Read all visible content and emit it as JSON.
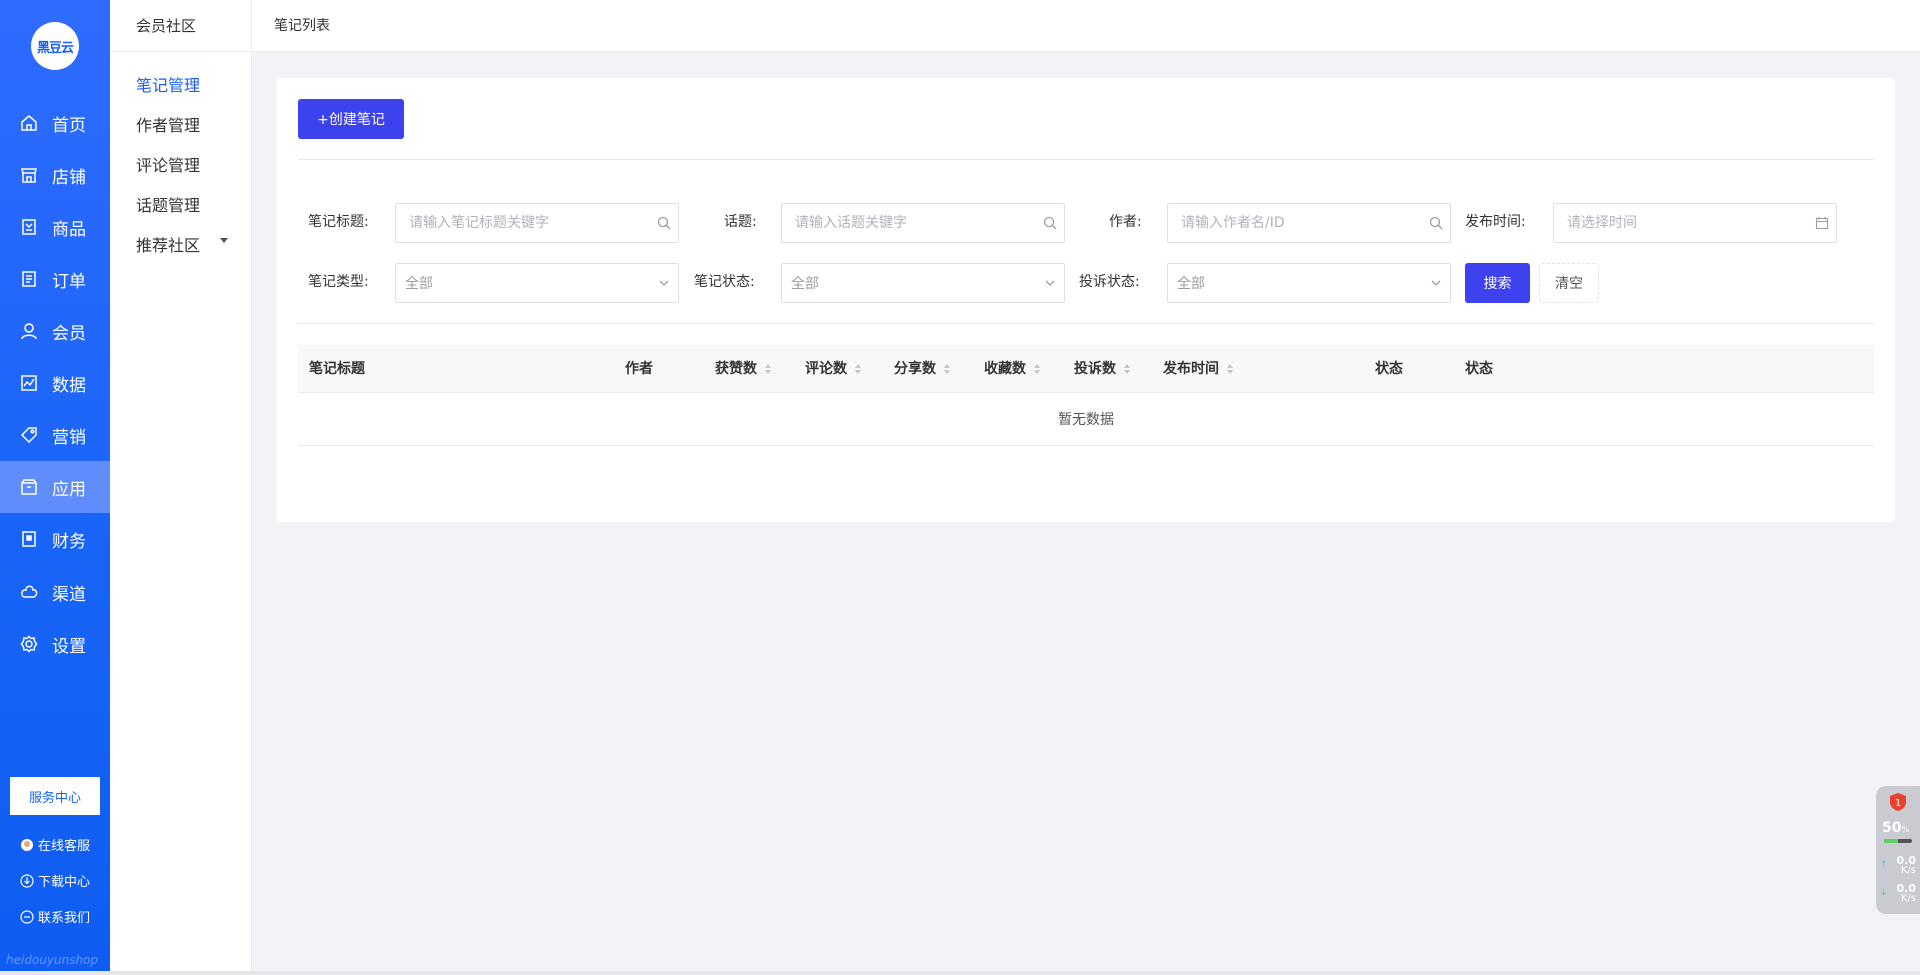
{
  "logo_text": "黑豆云",
  "nav": [
    {
      "label": "首页",
      "icon": "home-icon"
    },
    {
      "label": "店铺",
      "icon": "store-icon"
    },
    {
      "label": "商品",
      "icon": "goods-icon"
    },
    {
      "label": "订单",
      "icon": "order-icon"
    },
    {
      "label": "会员",
      "icon": "user-icon"
    },
    {
      "label": "数据",
      "icon": "chart-icon"
    },
    {
      "label": "营销",
      "icon": "tag-icon"
    },
    {
      "label": "应用",
      "icon": "app-icon"
    },
    {
      "label": "财务",
      "icon": "finance-icon"
    },
    {
      "label": "渠道",
      "icon": "channel-icon"
    },
    {
      "label": "设置",
      "icon": "gear-icon"
    }
  ],
  "active_nav": "应用",
  "service_center": "服务中心",
  "footer_links": {
    "online_service": "在线客服",
    "download": "下载中心",
    "contact": "联系我们"
  },
  "watermark": "heidouyunshop",
  "subnav": {
    "title": "会员社区",
    "items": [
      {
        "label": "笔记管理"
      },
      {
        "label": "作者管理"
      },
      {
        "label": "评论管理"
      },
      {
        "label": "话题管理"
      },
      {
        "label": "推荐社区"
      }
    ]
  },
  "breadcrumb": "笔记列表",
  "create_button": "+创建笔记",
  "filters": {
    "title": {
      "label": "笔记标题:",
      "placeholder": "请输入笔记标题关键字"
    },
    "topic": {
      "label": "话题:",
      "placeholder": "请输入话题关键字"
    },
    "author": {
      "label": "作者:",
      "placeholder": "请输入作者名/ID"
    },
    "publish_time": {
      "label": "发布时间:",
      "placeholder": "请选择时间"
    },
    "note_type": {
      "label": "笔记类型:",
      "value": "全部"
    },
    "note_status": {
      "label": "笔记状态:",
      "value": "全部"
    },
    "complaint_status": {
      "label": "投诉状态:",
      "value": "全部"
    }
  },
  "search_button": "搜索",
  "clear_button": "清空",
  "table": {
    "columns": [
      "笔记标题",
      "作者",
      "获赞数",
      "评论数",
      "分享数",
      "收藏数",
      "投诉数",
      "发布时间",
      "状态",
      "状态"
    ],
    "empty_text": "暂无数据"
  },
  "net_widget": {
    "badge": "1",
    "percent": "50",
    "percent_unit": "%",
    "up": "0.0",
    "down": "0.0",
    "unit": "K/s",
    "percent_value": 0.5
  },
  "colors": {
    "sidebar": "#1764f7",
    "primary_button": "#3d41ee",
    "active_sub": "#1a5ef5"
  }
}
